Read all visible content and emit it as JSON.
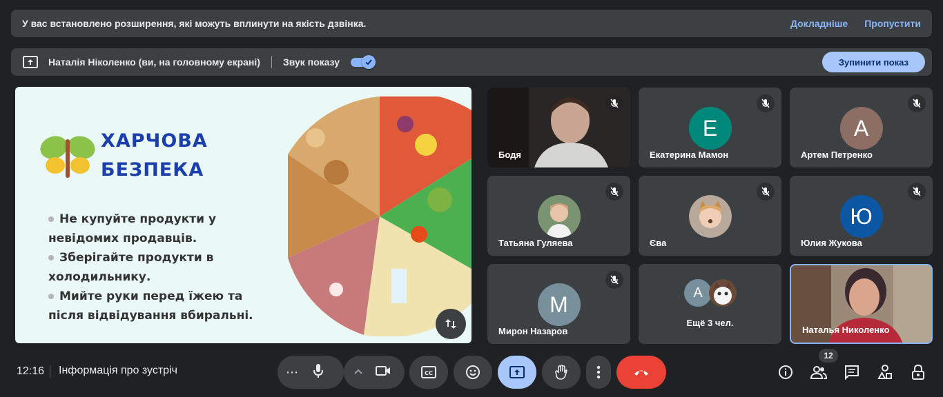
{
  "banner": {
    "text": "У вас встановлено розширення, які можуть вплинути на якість дзвінка.",
    "learn_more": "Докладніше",
    "skip": "Пропустити"
  },
  "presentation": {
    "presenter": "Наталія Ніколенко (ви, на головному екрані)",
    "sound_label": "Звук показу",
    "sound_on": true,
    "stop_label": "Зупинити показ"
  },
  "slide": {
    "title_line1": "ХАРЧОВА",
    "title_line2": "БЕЗПЕКА",
    "bullets": [
      "Не купуйте продукти у",
      "невідомих продавців.",
      "Зберігайте продукти в",
      "холодильнику.",
      "Мийте руки перед їжею та",
      "після відвідування вбиральні."
    ]
  },
  "participants": [
    {
      "name": "Бодя",
      "type": "video",
      "muted": true
    },
    {
      "name": "Екатерина Мамон",
      "initial": "Е",
      "color": "#00897b",
      "muted": true
    },
    {
      "name": "Артем Петренко",
      "initial": "А",
      "color": "#8d6e63",
      "muted": true
    },
    {
      "name": "Татьяна Гуляева",
      "type": "photo",
      "muted": true
    },
    {
      "name": "Єва",
      "type": "photo",
      "muted": true
    },
    {
      "name": "Юлия Жукова",
      "initial": "Ю",
      "color": "#0b57a4",
      "muted": true
    },
    {
      "name": "Мирон Назаров",
      "initial": "М",
      "color": "#78909c",
      "muted": true
    },
    {
      "name": "Ещё 3 чел.",
      "initial": "А",
      "color": "#78909c",
      "type": "more"
    },
    {
      "name": "Наталья Николенко",
      "type": "video-self"
    }
  ],
  "footer": {
    "time": "12:16",
    "meeting_info": "Інформація про зустріч",
    "people_count": "12"
  },
  "icons": [
    "more-icon",
    "mic-icon",
    "chevron-up-icon",
    "camera-icon",
    "captions-icon",
    "emoji-icon",
    "present-icon",
    "raise-hand-icon",
    "more-vert-icon",
    "end-call-icon",
    "info-icon",
    "people-icon",
    "chat-icon",
    "activities-icon",
    "host-controls-icon"
  ]
}
